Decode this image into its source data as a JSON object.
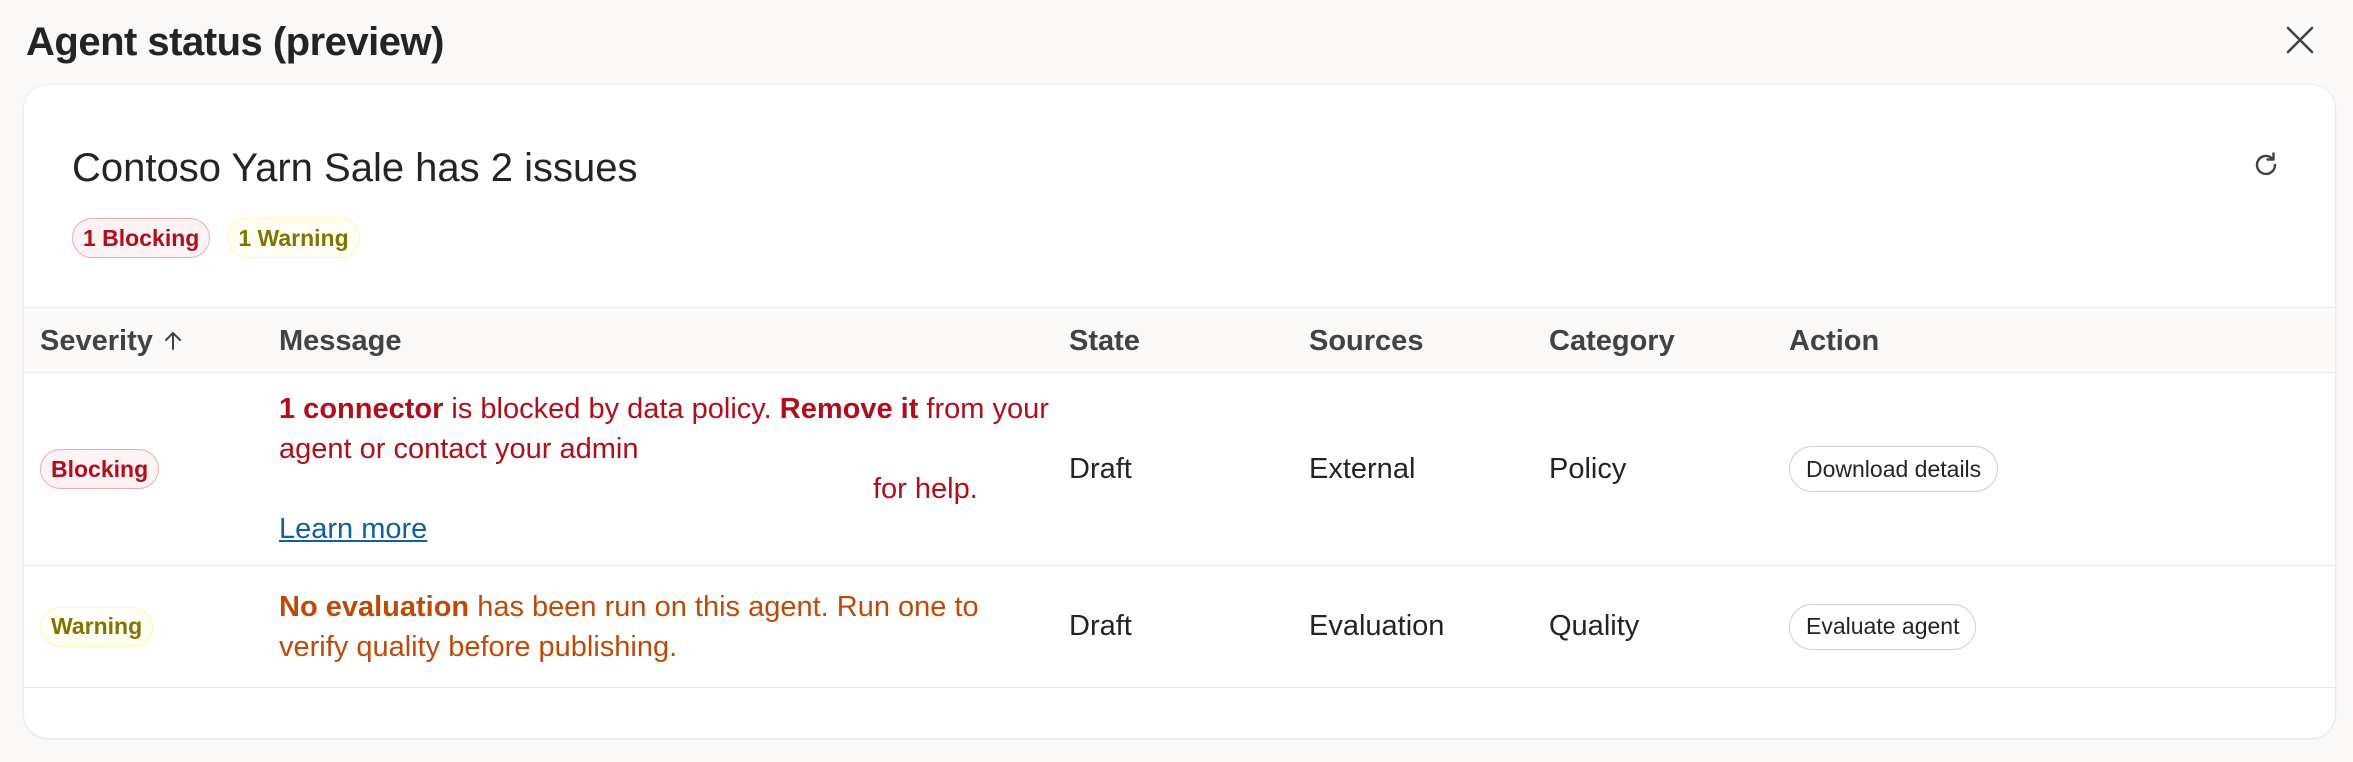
{
  "panel": {
    "title": "Agent status (preview)",
    "close_icon": "close-icon"
  },
  "card": {
    "title": "Contoso Yarn Sale has 2 issues",
    "refresh_icon": "refresh-icon",
    "badges": {
      "blocking": "1 Blocking",
      "warning": "1 Warning"
    }
  },
  "table": {
    "headers": {
      "severity": "Severity",
      "message": "Message",
      "state": "State",
      "sources": "Sources",
      "category": "Category",
      "action": "Action"
    },
    "sort_icon": "arrow-up-icon",
    "rows": [
      {
        "severity": "Blocking",
        "message": {
          "bold1": "1 connector",
          "text1": " is blocked by data policy. ",
          "bold2": "Remove it",
          "text2": " from your agent or contact your admin",
          "text3": "for help.",
          "link": "Learn more"
        },
        "state": "Draft",
        "sources": "External",
        "category": "Policy",
        "action": "Download details"
      },
      {
        "severity": "Warning",
        "message": {
          "bold1": "No evaluation",
          "text1": " has been run on this agent. Run one to verify quality before publishing."
        },
        "state": "Draft",
        "sources": "Evaluation",
        "category": "Quality",
        "action": "Evaluate agent"
      }
    ]
  },
  "colors": {
    "blocking": "#b10e1c",
    "warning_badge": "#817400",
    "warning_text": "#bc4b09",
    "link": "#115ea3"
  }
}
